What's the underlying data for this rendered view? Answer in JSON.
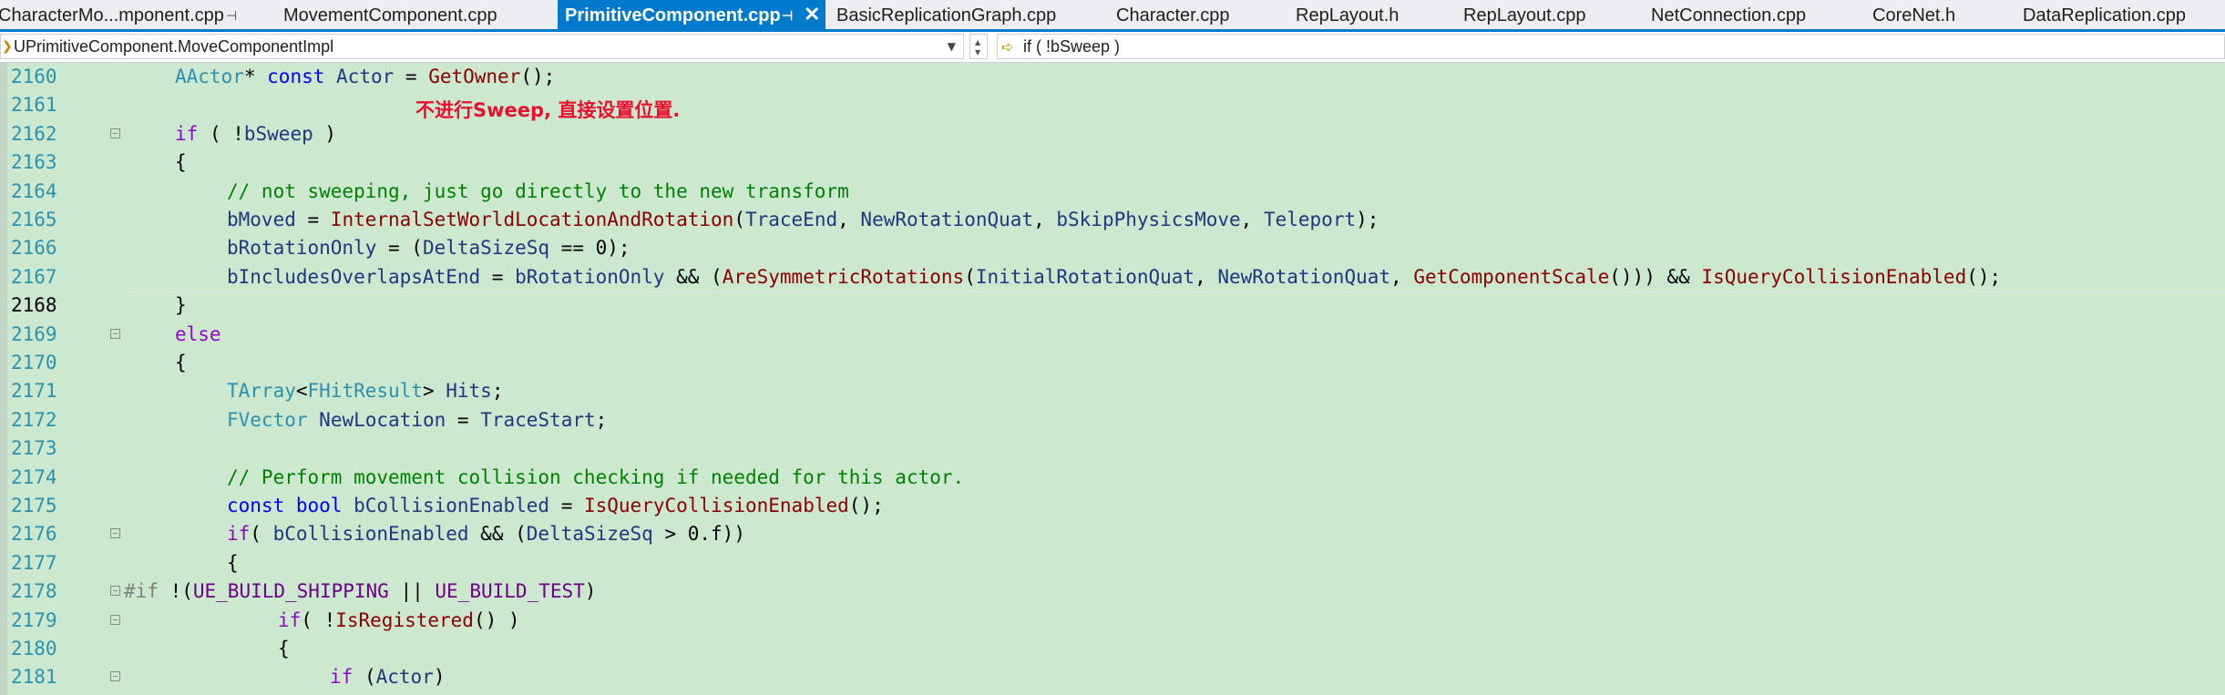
{
  "tabs": [
    {
      "label": "CharacterMo...mponent.cpp",
      "pinned": true
    },
    {
      "label": "MovementComponent.cpp"
    },
    {
      "label": "PrimitiveComponent.cpp",
      "active": true,
      "pinned": true
    },
    {
      "label": "BasicReplicationGraph.cpp"
    },
    {
      "label": "Character.cpp"
    },
    {
      "label": "RepLayout.h"
    },
    {
      "label": "RepLayout.cpp"
    },
    {
      "label": "NetConnection.cpp"
    },
    {
      "label": "CoreNet.h"
    },
    {
      "label": "DataReplication.cpp"
    }
  ],
  "navbar": {
    "scope": "UPrimitiveComponent.MoveComponentImpl",
    "member": "if ( !bSweep )"
  },
  "annotation": "不进行Sweep, 直接设置位置.",
  "editor": {
    "current_line": 2168,
    "lines": [
      {
        "num": "2160",
        "text": "AActor* const Actor = GetOwner();"
      },
      {
        "num": "2161",
        "text": ""
      },
      {
        "num": "2162",
        "text": "if ( !bSweep )"
      },
      {
        "num": "2163",
        "text": "{"
      },
      {
        "num": "2164",
        "text": "// not sweeping, just go directly to the new transform"
      },
      {
        "num": "2165",
        "text": "bMoved = InternalSetWorldLocationAndRotation(TraceEnd, NewRotationQuat, bSkipPhysicsMove, Teleport);"
      },
      {
        "num": "2166",
        "text": "bRotationOnly = (DeltaSizeSq == 0);"
      },
      {
        "num": "2167",
        "text": "bIncludesOverlapsAtEnd = bRotationOnly && (AreSymmetricRotations(InitialRotationQuat, NewRotationQuat, GetComponentScale())) && IsQueryCollisionEnabled();"
      },
      {
        "num": "2168",
        "text": "}"
      },
      {
        "num": "2169",
        "text": "else"
      },
      {
        "num": "2170",
        "text": "{"
      },
      {
        "num": "2171",
        "text": "TArray<FHitResult> Hits;"
      },
      {
        "num": "2172",
        "text": "FVector NewLocation = TraceStart;"
      },
      {
        "num": "2173",
        "text": ""
      },
      {
        "num": "2174",
        "text": "// Perform movement collision checking if needed for this actor."
      },
      {
        "num": "2175",
        "text": "const bool bCollisionEnabled = IsQueryCollisionEnabled();"
      },
      {
        "num": "2176",
        "text": "if( bCollisionEnabled && (DeltaSizeSq > 0.f))"
      },
      {
        "num": "2177",
        "text": "{"
      },
      {
        "num": "2178",
        "text": "#if !(UE_BUILD_SHIPPING || UE_BUILD_TEST)"
      },
      {
        "num": "2179",
        "text": "if( !IsRegistered() )"
      },
      {
        "num": "2180",
        "text": "{"
      },
      {
        "num": "2181",
        "text": "if (Actor)"
      }
    ]
  },
  "colors": {
    "background": "#cce8cf",
    "active_tab": "#007acc",
    "annotation": "#e8112d",
    "comment": "#008000",
    "keyword": "#0000ff",
    "line_number": "#2b91af"
  }
}
